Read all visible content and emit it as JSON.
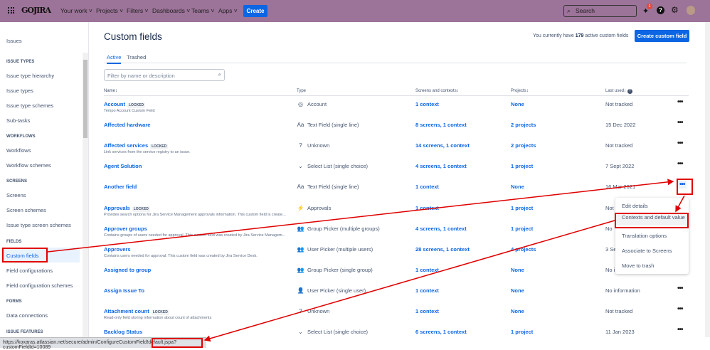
{
  "topbar": {
    "logo": "GOJIRA",
    "nav": [
      "Your work",
      "Projects",
      "Filters",
      "Dashboards",
      "Teams",
      "Apps"
    ],
    "create": "Create",
    "search_placeholder": "Search",
    "notifications": "1"
  },
  "sidebar": {
    "top": "Issues",
    "sections": [
      {
        "heading": "ISSUE TYPES",
        "items": [
          "Issue type hierarchy",
          "Issue types",
          "Issue type schemes",
          "Sub-tasks"
        ]
      },
      {
        "heading": "WORKFLOWS",
        "items": [
          "Workflows",
          "Workflow schemes"
        ]
      },
      {
        "heading": "SCREENS",
        "items": [
          "Screens",
          "Screen schemes",
          "Issue type screen schemes"
        ]
      },
      {
        "heading": "FIELDS",
        "items": [
          "Custom fields",
          "Field configurations",
          "Field configuration schemes"
        ]
      },
      {
        "heading": "FORMS",
        "items": [
          "Data connections"
        ]
      },
      {
        "heading": "ISSUE FEATURES",
        "items": []
      }
    ]
  },
  "page": {
    "title": "Custom fields",
    "count_prefix": "You currently have",
    "count": "179",
    "count_suffix": "active custom fields",
    "create_button": "Create custom field",
    "tabs": [
      "Active",
      "Trashed"
    ],
    "filter_placeholder": "Filter by name or description"
  },
  "table": {
    "headers": [
      "Name",
      "Type",
      "Screens and contexts",
      "Projects",
      "Last used"
    ],
    "rows": [
      {
        "name": "Account",
        "locked": "LOCKED",
        "desc": "Tempo Account Custom Field",
        "icon": "account-icon",
        "type": "Account",
        "screens": "1 context",
        "projects": "None",
        "last": "Not tracked"
      },
      {
        "name": "Affected hardware",
        "locked": "",
        "desc": "",
        "icon": "text-field-icon",
        "type": "Text Field (single line)",
        "screens": "8 screens, 1 context",
        "projects": "2 projects",
        "last": "15 Dec 2022"
      },
      {
        "name": "Affected services",
        "locked": "LOCKED",
        "desc": "Link services from the service registry to an issue.",
        "icon": "unknown-icon",
        "type": "Unknown",
        "screens": "14 screens, 1 context",
        "projects": "2 projects",
        "last": "Not tracked"
      },
      {
        "name": "Agent Solution",
        "locked": "",
        "desc": "",
        "icon": "select-list-icon",
        "type": "Select List (single choice)",
        "screens": "4 screens, 1 context",
        "projects": "1 project",
        "last": "7 Sept 2022"
      },
      {
        "name": "Another field",
        "locked": "",
        "desc": "",
        "icon": "text-field-icon",
        "type": "Text Field (single line)",
        "screens": "1 context",
        "projects": "None",
        "last": "16 Mar 2021"
      },
      {
        "name": "Approvals",
        "locked": "LOCKED",
        "desc": "Provides search options for Jira Service Management approvals information. This custom field is create...",
        "icon": "approvals-icon",
        "type": "Approvals",
        "screens": "1 context",
        "projects": "1 project",
        "last": "Not tracked"
      },
      {
        "name": "Approver groups",
        "locked": "",
        "desc": "Contains groups of users needed for approval. This custom field was created by Jira Service Managem...",
        "icon": "group-icon",
        "type": "Group Picker (multiple groups)",
        "screens": "4 screens, 1 context",
        "projects": "1 project",
        "last": "No"
      },
      {
        "name": "Approvers",
        "locked": "",
        "desc": "Contains users needed for approval. This custom field was created by Jira Service Desk.",
        "icon": "users-icon",
        "type": "User Picker (multiple users)",
        "screens": "28 screens, 1 context",
        "projects": "4 projects",
        "last": "3 Se"
      },
      {
        "name": "Assigned to group",
        "locked": "",
        "desc": "",
        "icon": "group-icon",
        "type": "Group Picker (single group)",
        "screens": "1 context",
        "projects": "None",
        "last": "No i"
      },
      {
        "name": "Assign Issue To",
        "locked": "",
        "desc": "",
        "icon": "user-icon",
        "type": "User Picker (single user)",
        "screens": "1 context",
        "projects": "None",
        "last": "No information"
      },
      {
        "name": "Attachment count",
        "locked": "LOCKED",
        "desc": "Read-only field storing information about count of attachments",
        "icon": "unknown-icon",
        "type": "Unknown",
        "screens": "1 context",
        "projects": "None",
        "last": "Not tracked"
      },
      {
        "name": "Backlog Status",
        "locked": "",
        "desc": "",
        "icon": "select-list-icon",
        "type": "Select List (single choice)",
        "screens": "6 screens, 1 context",
        "projects": "1 project",
        "last": "11 Jan 2023"
      }
    ]
  },
  "menu": [
    "Edit details",
    "Contexts and default value",
    "Translation options",
    "Associate to Screens",
    "Move to trash"
  ],
  "status_url": "https://koxaras.atlassian.net/secure/admin/ConfigureCustomField!default.jspa?customFieldId=10089",
  "colors": {
    "topbar": "#9c7399",
    "link": "#0c66e4",
    "annotation": "#e00000"
  }
}
